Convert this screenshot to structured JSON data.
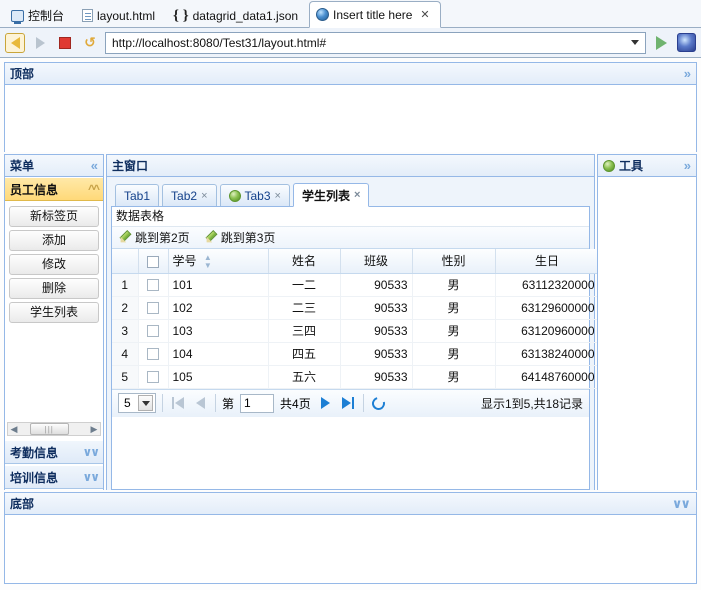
{
  "browser": {
    "tabs": [
      {
        "label": "控制台",
        "icon": "console-icon",
        "active": false,
        "closable": false
      },
      {
        "label": "layout.html",
        "icon": "document-icon",
        "active": false,
        "closable": false
      },
      {
        "label": "datagrid_data1.json",
        "icon": "json-brace-icon",
        "active": false,
        "closable": false
      },
      {
        "label": "Insert title here",
        "icon": "globe-icon",
        "active": true,
        "closable": true
      }
    ],
    "close_glyph": "✕",
    "toolbar": {
      "back": "back-arrow-icon",
      "forward": "forward-arrow-icon",
      "stop": "stop-icon",
      "refresh": "refresh-icon",
      "go": "go-play-icon",
      "open_external": "open-browser-icon"
    },
    "url": "http://localhost:8080/Test31/layout.html#"
  },
  "layout": {
    "north": {
      "title": "顶部",
      "collapse_icon": "chevron-up-double"
    },
    "south": {
      "title": "底部",
      "collapse_icon": "chevron-down-double"
    },
    "west": {
      "title": "菜单",
      "collapse_icon": "chevron-left-double",
      "accordion": [
        {
          "title": "员工信息",
          "selected": true,
          "chevron": "chevron-up-double",
          "buttons": [
            "新标签页",
            "添加",
            "修改",
            "删除",
            "学生列表"
          ]
        },
        {
          "title": "考勤信息",
          "selected": false,
          "chevron": "chevron-down-double",
          "buttons": []
        },
        {
          "title": "培训信息",
          "selected": false,
          "chevron": "chevron-down-double",
          "buttons": []
        }
      ]
    },
    "east": {
      "title": "工具",
      "icon": "green-refresh-icon",
      "collapse_icon": "chevron-right-double"
    },
    "center": {
      "title": "主窗口",
      "tabs": [
        {
          "label": "Tab1",
          "active": false,
          "closable": false,
          "icon": null
        },
        {
          "label": "Tab2",
          "active": false,
          "closable": true,
          "icon": null
        },
        {
          "label": "Tab3",
          "active": false,
          "closable": true,
          "icon": "green-refresh-icon"
        },
        {
          "label": "学生列表",
          "active": true,
          "closable": true,
          "icon": null
        }
      ],
      "close_glyph": "×"
    }
  },
  "datagrid": {
    "title": "数据表格",
    "toolbar": [
      {
        "label": "跳到第2页",
        "icon": "pencil-icon"
      },
      {
        "label": "跳到第3页",
        "icon": "pencil-icon"
      }
    ],
    "columns": [
      {
        "field": "rownum",
        "label": "",
        "align": "center"
      },
      {
        "field": "check",
        "label": "",
        "align": "center"
      },
      {
        "field": "id",
        "label": "学号",
        "align": "left",
        "sortable": true
      },
      {
        "field": "name",
        "label": "姓名",
        "align": "center"
      },
      {
        "field": "clazz",
        "label": "班级",
        "align": "right"
      },
      {
        "field": "gender",
        "label": "性别",
        "align": "center"
      },
      {
        "field": "birthday",
        "label": "生日",
        "align": "right"
      }
    ],
    "rows": [
      {
        "rownum": "1",
        "id": "101",
        "name": "一二",
        "clazz": "90533",
        "gender": "男",
        "birthday": "63112320000"
      },
      {
        "rownum": "2",
        "id": "102",
        "name": "二三",
        "clazz": "90533",
        "gender": "男",
        "birthday": "63129600000"
      },
      {
        "rownum": "3",
        "id": "103",
        "name": "三四",
        "clazz": "90533",
        "gender": "男",
        "birthday": "63120960000"
      },
      {
        "rownum": "4",
        "id": "104",
        "name": "四五",
        "clazz": "90533",
        "gender": "男",
        "birthday": "63138240000"
      },
      {
        "rownum": "5",
        "id": "105",
        "name": "五六",
        "clazz": "90533",
        "gender": "男",
        "birthday": "64148760000"
      }
    ],
    "pager": {
      "page_size": "5",
      "page_size_arrow": "chevron-down-icon",
      "first_icon": "first-page-icon",
      "prev_icon": "prev-page-icon",
      "next_icon": "next-page-icon",
      "last_icon": "last-page-icon",
      "refresh_icon": "refresh-icon",
      "label_before": "第",
      "page_number": "1",
      "label_after": "共4页",
      "info": "显示1到5,共18记录"
    }
  },
  "colors": {
    "panel_border": "#95b8e7",
    "header_text": "#0e2d5e",
    "accordion_selected": "#ffd979",
    "pager_active": "#1d7fd4",
    "tab_text": "#15428b"
  }
}
